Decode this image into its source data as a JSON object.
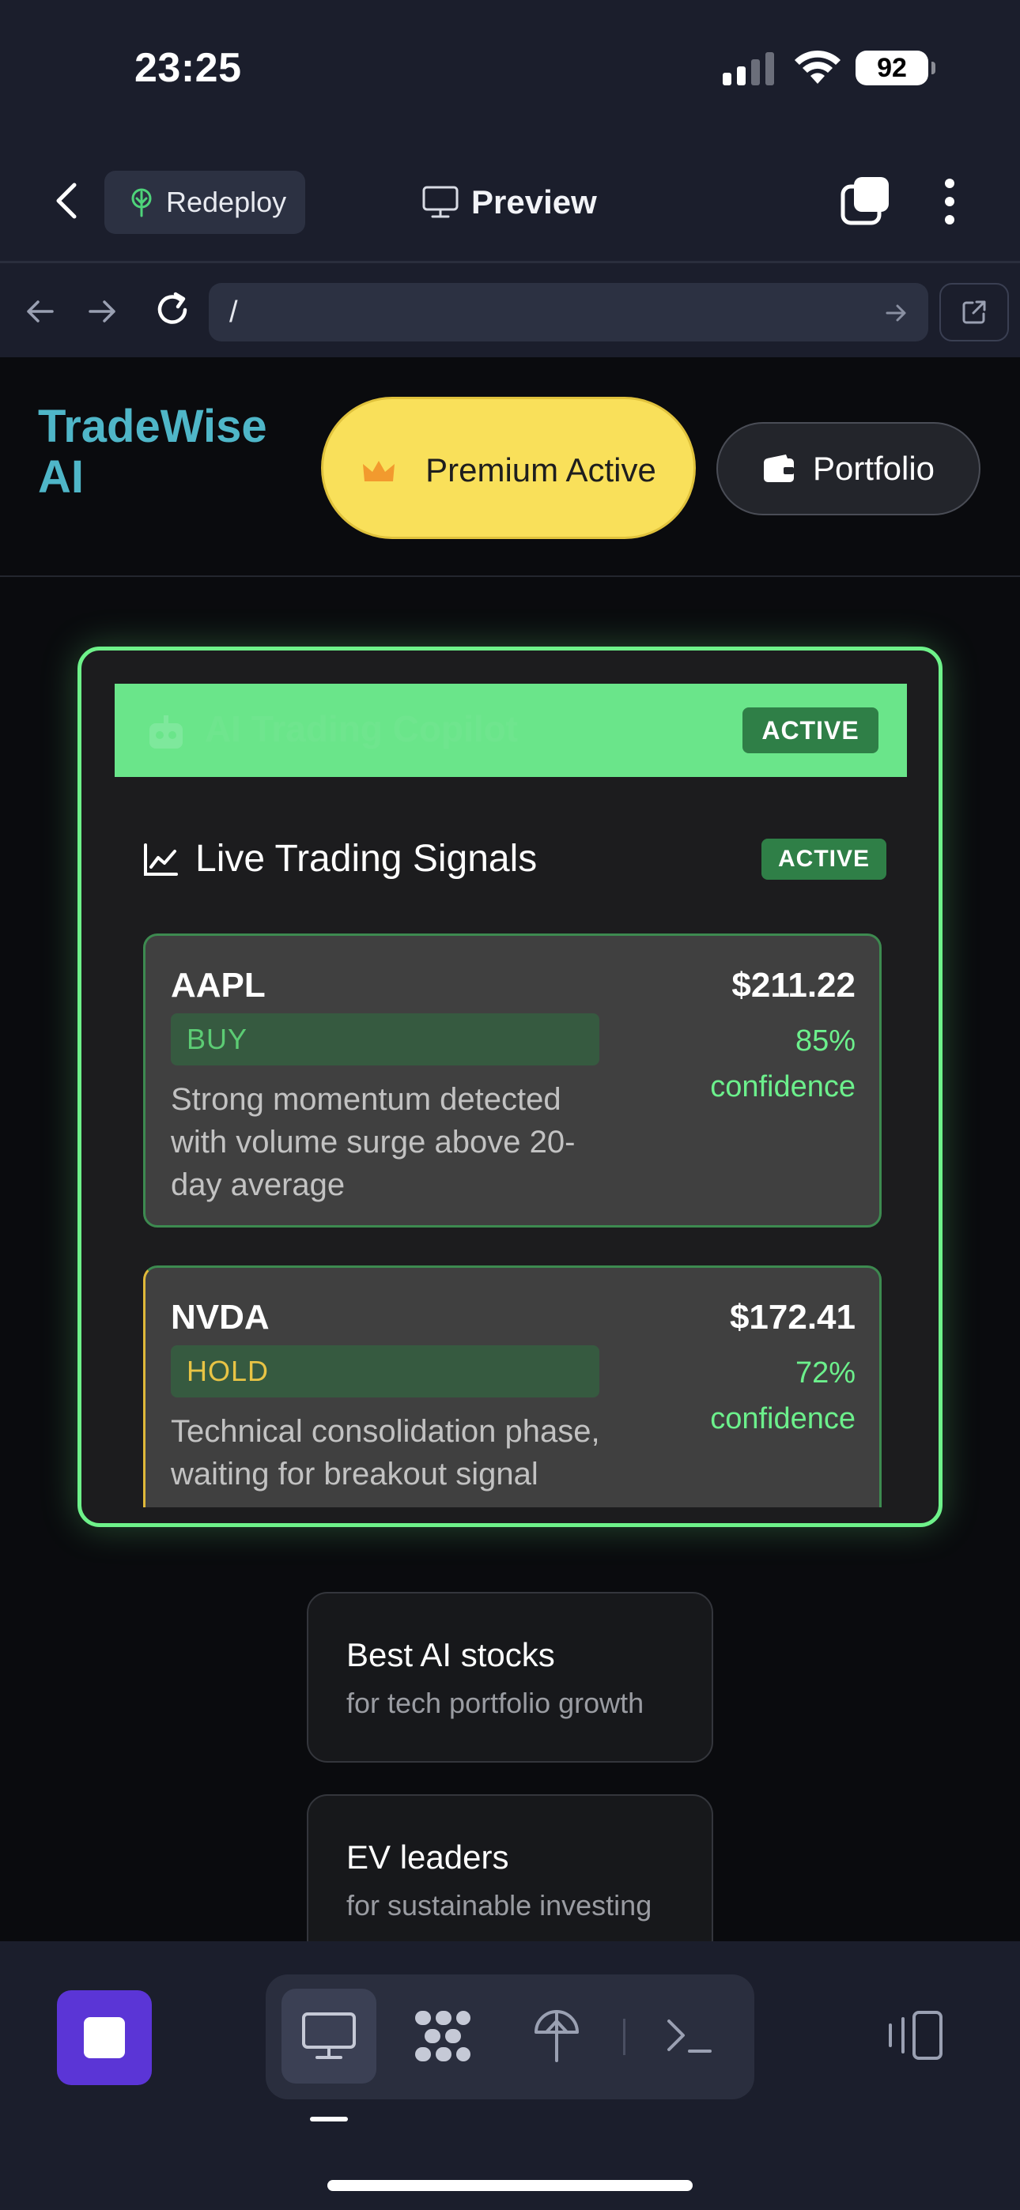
{
  "status_bar": {
    "time": "23:25",
    "battery": "92",
    "icons": [
      "signal-icon",
      "wifi-icon",
      "battery-icon"
    ]
  },
  "app_bar": {
    "back_icon": "chevron-left-icon",
    "redeploy_label": "Redeploy",
    "redeploy_icon": "tree-icon",
    "title": "Preview",
    "title_icon": "monitor-icon",
    "tabs_icon": "tabs-icon",
    "more_icon": "more-vertical-icon"
  },
  "url_bar": {
    "value": "/",
    "icons": [
      "arrow-left-icon",
      "arrow-right-icon",
      "reload-icon",
      "go-arrow-icon",
      "external-link-icon"
    ]
  },
  "site": {
    "brand": "TradeWise AI",
    "premium_label": "Premium Active",
    "portfolio_label": "Portfolio",
    "colors": {
      "brand": "#4fb6c8",
      "premium": "#f9e05a",
      "accent_green": "#6ef28a",
      "buy": "#5ccc74",
      "hold": "#e8c445"
    }
  },
  "copilot": {
    "title": "AI Trading Copilot",
    "status": "ACTIVE",
    "section_title": "Live Trading Signals",
    "section_status": "ACTIVE",
    "signals": [
      {
        "ticker": "AAPL",
        "action": "BUY",
        "reason": "Strong momentum detected with volume surge above 20-day average",
        "price": "$211.22",
        "confidence": "85% confidence"
      },
      {
        "ticker": "NVDA",
        "action": "HOLD",
        "reason": "Technical consolidation phase, waiting for breakout signal",
        "price": "$172.41",
        "confidence": "72% confidence"
      }
    ]
  },
  "suggestions": [
    {
      "title": "Best AI stocks",
      "subtitle": "for tech portfolio growth"
    },
    {
      "title": "EV leaders",
      "subtitle": "for sustainable investing"
    }
  ],
  "toolbar": {
    "icons": [
      "stop-icon",
      "monitor-icon",
      "network-icon",
      "deploy-icon",
      "terminal-icon",
      "side-panel-icon"
    ],
    "active": "monitor-icon"
  }
}
